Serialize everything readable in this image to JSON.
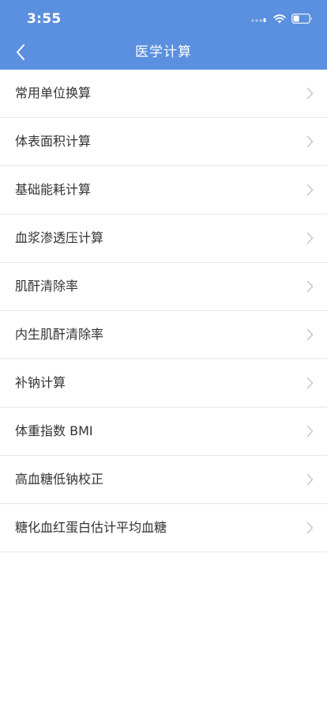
{
  "status_bar": {
    "time": "3:55"
  },
  "nav": {
    "title": "医学计算",
    "back_icon": "chevron-left-icon"
  },
  "colors": {
    "header_bg": "#5b8fdf",
    "text": "#333333",
    "divider": "#e6e6e6",
    "chevron": "#c7c7cc"
  },
  "list": {
    "items": [
      {
        "label": "常用单位换算"
      },
      {
        "label": "体表面积计算"
      },
      {
        "label": "基础能耗计算"
      },
      {
        "label": "血浆渗透压计算"
      },
      {
        "label": "肌酐清除率"
      },
      {
        "label": "内生肌酐清除率"
      },
      {
        "label": "补钠计算"
      },
      {
        "label": "体重指数 BMI"
      },
      {
        "label": "高血糖低钠校正"
      },
      {
        "label": "糖化血红蛋白估计平均血糖"
      }
    ]
  }
}
